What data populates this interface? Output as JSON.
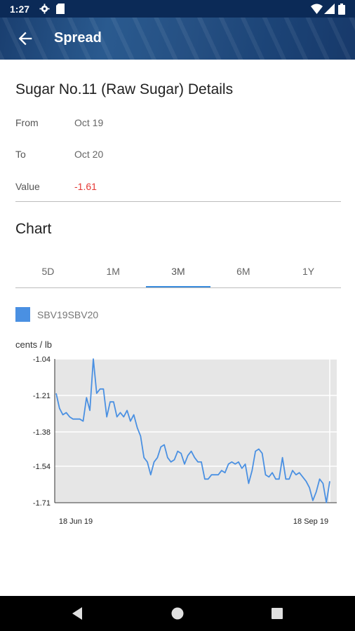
{
  "status_bar": {
    "time": "1:27"
  },
  "app_bar": {
    "title": "Spread"
  },
  "details": {
    "title": "Sugar No.11 (Raw Sugar) Details",
    "rows": [
      {
        "label": "From",
        "value": "Oct 19"
      },
      {
        "label": "To",
        "value": "Oct 20"
      },
      {
        "label": "Value",
        "value": "-1.61"
      }
    ]
  },
  "chart_section": {
    "title": "Chart",
    "tabs": [
      "5D",
      "1M",
      "3M",
      "6M",
      "1Y"
    ],
    "active_tab": "3M",
    "accent_color": "#3a8dde",
    "negative_color": "#e53935"
  },
  "chart_data": {
    "type": "line",
    "unit_label": "cents / lb",
    "series": [
      {
        "name": "SBV19SBV20",
        "color": "#4a90e2",
        "values": [
          -1.2,
          -1.27,
          -1.3,
          -1.29,
          -1.31,
          -1.32,
          -1.32,
          -1.32,
          -1.33,
          -1.22,
          -1.28,
          -1.04,
          -1.2,
          -1.18,
          -1.18,
          -1.31,
          -1.24,
          -1.24,
          -1.31,
          -1.29,
          -1.31,
          -1.28,
          -1.33,
          -1.3,
          -1.36,
          -1.4,
          -1.5,
          -1.52,
          -1.58,
          -1.52,
          -1.5,
          -1.45,
          -1.44,
          -1.5,
          -1.52,
          -1.51,
          -1.47,
          -1.48,
          -1.53,
          -1.49,
          -1.47,
          -1.5,
          -1.52,
          -1.52,
          -1.6,
          -1.6,
          -1.58,
          -1.58,
          -1.58,
          -1.56,
          -1.57,
          -1.53,
          -1.52,
          -1.53,
          -1.52,
          -1.55,
          -1.53,
          -1.62,
          -1.56,
          -1.47,
          -1.46,
          -1.48,
          -1.58,
          -1.59,
          -1.57,
          -1.6,
          -1.6,
          -1.5,
          -1.6,
          -1.6,
          -1.56,
          -1.58,
          -1.57,
          -1.59,
          -1.61,
          -1.64,
          -1.7,
          -1.66,
          -1.6,
          -1.62,
          -1.71,
          -1.61
        ]
      }
    ],
    "y_ticks": [
      "-1.04",
      "-1.21",
      "-1.38",
      "-1.54",
      "-1.71"
    ],
    "x_labels": [
      "18 Jun 19",
      "18 Sep 19"
    ],
    "ylim": [
      -1.71,
      -1.04
    ],
    "grid": true
  }
}
